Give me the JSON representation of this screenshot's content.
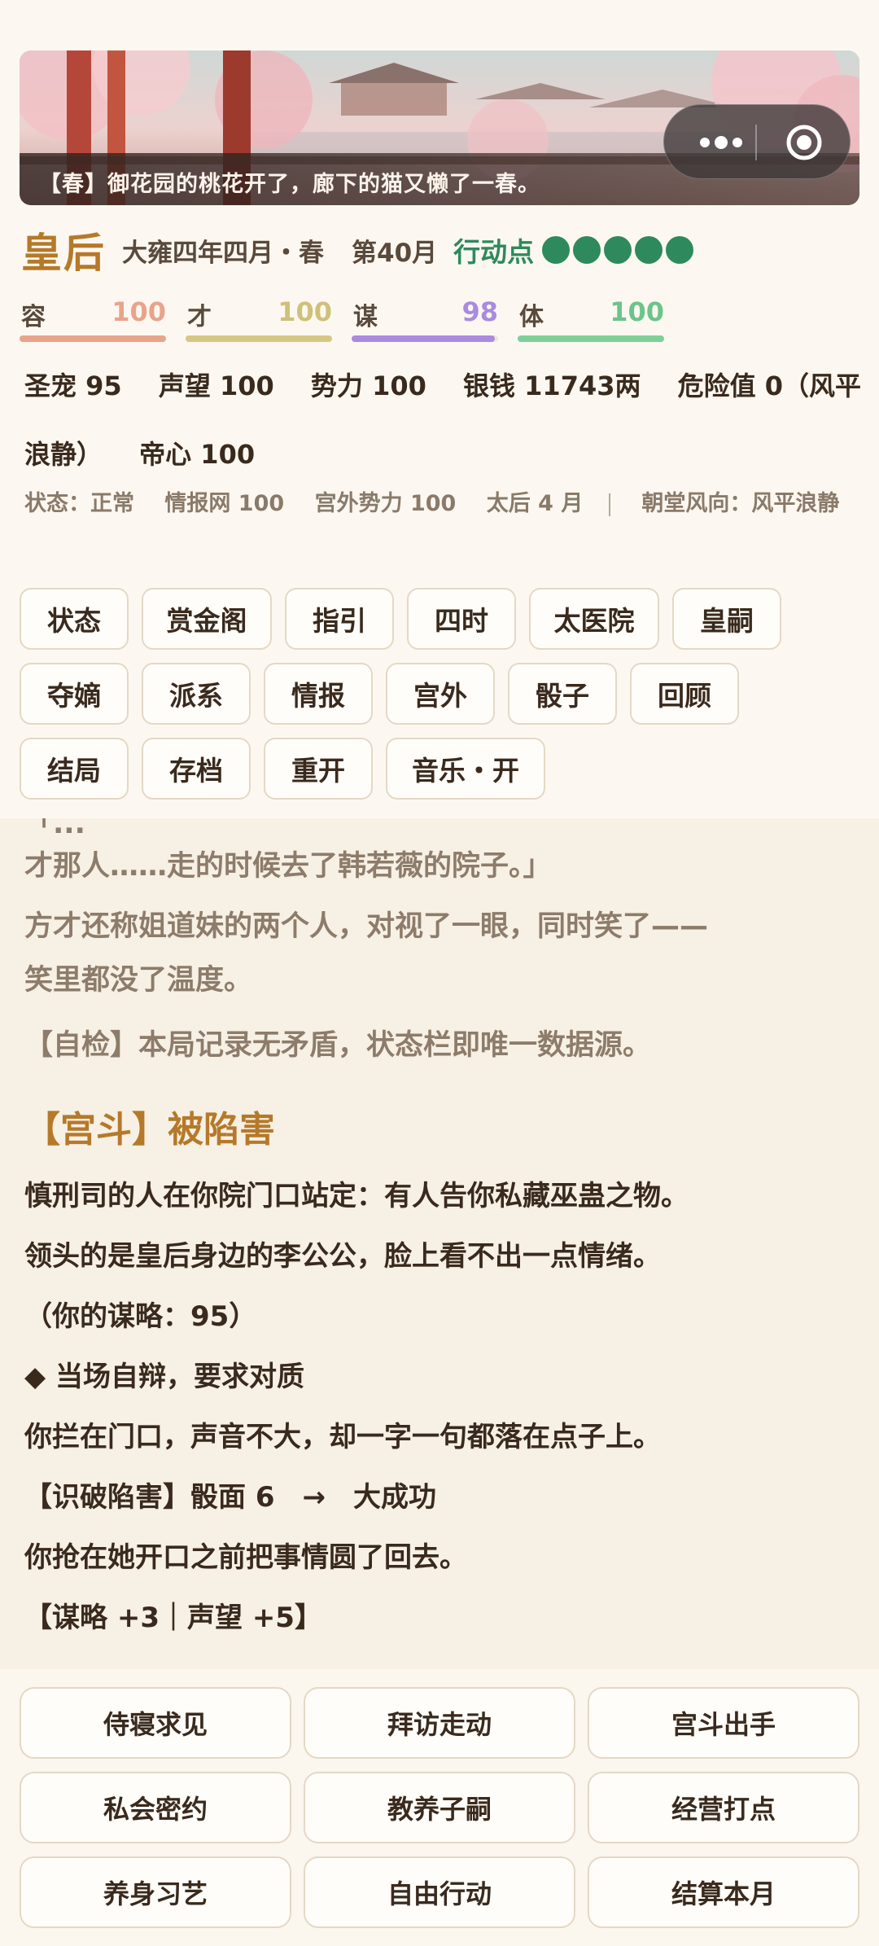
{
  "banner": {
    "caption": "【春】御花园的桃花开了，廊下的猫又懒了一春。"
  },
  "capsule": {
    "more_icon": "more-dots-icon",
    "close_icon": "target-icon"
  },
  "header": {
    "role": "皇后",
    "date": "大雍四年四月・春",
    "month": "第40月",
    "action_points_label": "行动点",
    "action_points": 5
  },
  "stats": [
    {
      "name": "容",
      "value": "100",
      "fraction": 1.0,
      "color": "#e8a48a"
    },
    {
      "name": "才",
      "value": "100",
      "fraction": 1.0,
      "color": "#d6c883"
    },
    {
      "name": "谋",
      "value": "98",
      "fraction": 0.98,
      "color": "#a98be0"
    },
    {
      "name": "体",
      "value": "100",
      "fraction": 1.0,
      "color": "#7fd098"
    }
  ],
  "info": {
    "items": [
      "圣宠 95",
      "声望 100",
      "势力 100",
      "银钱 11743两",
      "危险值 0（风平浪静）",
      "帝心 100"
    ]
  },
  "sub_info": {
    "items": [
      "状态：正常",
      "情报网 100",
      "宫外势力 100",
      "太后 4 月"
    ],
    "court": "朝堂风向：风平浪静"
  },
  "menu": {
    "row1": [
      "状态",
      "赏金阁",
      "指引",
      "四时",
      "太医院",
      "皇嗣"
    ],
    "row2": [
      "夺嫡",
      "派系",
      "情报",
      "宫外",
      "骰子",
      "回顾"
    ],
    "row3": [
      "结局",
      "存档",
      "重开",
      "音乐・开"
    ]
  },
  "story": {
    "l0": "「...",
    "l1": "才那人……走的时候去了韩若薇的院子。」",
    "l2": "方才还称姐道妹的两个人，对视了一眼，同时笑了——",
    "l3": "笑里都没了温度。",
    "l4": "【自检】本局记录无矛盾，状态栏即唯一数据源。",
    "heading": "【宫斗】被陷害",
    "l5": "慎刑司的人在你院门口站定：有人告你私藏巫蛊之物。",
    "l6": "领头的是皇后身边的李公公，脸上看不出一点情绪。",
    "l7": "（你的谋略：95）",
    "l8": "◆ 当场自辩，要求对质",
    "l9": "你拦在门口，声音不大，却一字一句都落在点子上。",
    "l10": "【识破陷害】骰面 6　→　大成功",
    "l11": "你抢在她开口之前把事情圆了回去。",
    "l12": "【谋略 +3｜声望 +5】"
  },
  "actions": [
    "侍寝求见",
    "拜访走动",
    "宫斗出手",
    "私会密约",
    "教养子嗣",
    "经营打点",
    "养身习艺",
    "自由行动",
    "结算本月"
  ]
}
